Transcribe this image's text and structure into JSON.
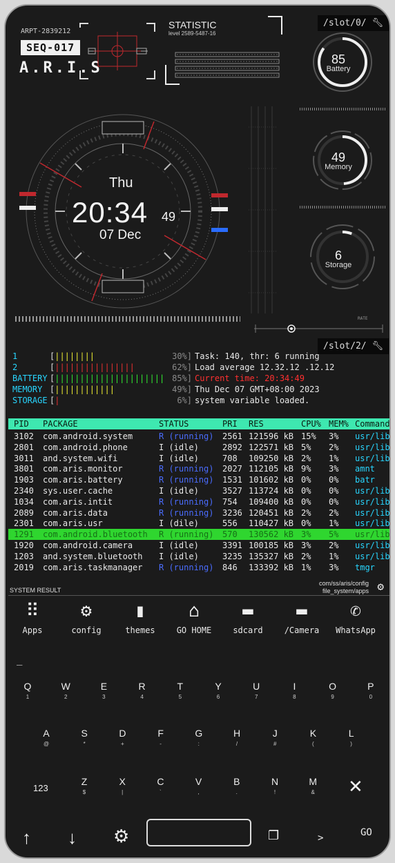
{
  "header": {
    "id_code": "ARPT-2839212",
    "seq": "SEQ-017",
    "brand": "A.R.I.S",
    "statistic_title": "STATISTIC",
    "statistic_level": "level 2589-5487-16",
    "slot0": "/slot/0/",
    "slot2": "/slot/2/"
  },
  "clock": {
    "day": "Thu",
    "time": "20:34",
    "seconds": "49",
    "date": "07 Dec"
  },
  "gauges": [
    {
      "value": "85",
      "label": "Battery",
      "fraction": 0.85
    },
    {
      "value": "49",
      "label": "Memory",
      "fraction": 0.49
    },
    {
      "value": "6",
      "label": "Storage",
      "fraction": 0.06
    }
  ],
  "rate_label": "RATE",
  "stats": [
    {
      "label": "1",
      "bars": 8,
      "bar_color": "#e8e830",
      "pct": "30%]",
      "msg": "Task: 140, thr: 6 running"
    },
    {
      "label": "2",
      "bars": 16,
      "bar_color": "#e83030",
      "pct": "62%]",
      "msg": "Load average 12.32.12 .12.12"
    },
    {
      "label": "BATTERY",
      "bars": 22,
      "bar_color": "#30e830",
      "pct": "85%]",
      "msg": "Current time: 20:34:49",
      "msg_color": "#ff3030"
    },
    {
      "label": "MEMORY",
      "bars": 12,
      "bar_color": "#e8e830",
      "pct": "49%]",
      "msg": "Thu Dec 07 GMT+08:00 2023"
    },
    {
      "label": "STORAGE",
      "bars": 1,
      "bar_color": "#e83030",
      "pct": "6%]",
      "msg": "system variable loaded."
    }
  ],
  "table": {
    "headers": [
      "PID",
      "PACKAGE",
      "STATUS",
      "PRI",
      "RES",
      "CPU%",
      "MEM%",
      "Command"
    ],
    "rows": [
      [
        "3102",
        "com.android.system",
        "R (running)",
        "2561",
        "121596 kB",
        "15%",
        "3%",
        "usr/lib"
      ],
      [
        "2801",
        "com.android.phone",
        "I (idle)",
        "2892",
        "122571 kB",
        "5%",
        "2%",
        "usr/lib"
      ],
      [
        "3011",
        "and.system.wifi",
        "I (idle)",
        "708",
        "109250 kB",
        "2%",
        "1%",
        "usr/lib"
      ],
      [
        "3801",
        "com.aris.monitor",
        "R (running)",
        "2027",
        "112105 kB",
        "9%",
        "3%",
        "amnt"
      ],
      [
        "1903",
        "com.aris.battery",
        "R (running)",
        "1531",
        "101602 kB",
        "0%",
        "0%",
        "batr"
      ],
      [
        "2340",
        "sys.user.cache",
        "I (idle)",
        "3527",
        "113724 kB",
        "0%",
        "0%",
        "usr/lib"
      ],
      [
        "1034",
        "com.aris.intit",
        "R (running)",
        "754",
        "109400 kB",
        "0%",
        "0%",
        "usr/lib"
      ],
      [
        "2089",
        "com.aris.data",
        "R (running)",
        "3236",
        "120451 kB",
        "2%",
        "2%",
        "usr/lib"
      ],
      [
        "2301",
        "com.aris.usr",
        "I (dile)",
        "556",
        "110427 kB",
        "0%",
        "1%",
        "usr/lib"
      ],
      [
        "1291",
        "com.android.bluetooth",
        "R (running)",
        "570",
        "130562 kB",
        "3%",
        "5%",
        "usr/lib"
      ],
      [
        "1920",
        "com.android.camera",
        "I (idle)",
        "3391",
        "100185 kB",
        "3%",
        "2%",
        "usr/lib"
      ],
      [
        "1203",
        "and.system.bluetooth",
        "I (idle)",
        "3235",
        "135327 kB",
        "2%",
        "1%",
        "usr/lib"
      ],
      [
        "2019",
        "com.aris.taskmanager",
        "R (running)",
        "846",
        "133392 kB",
        "1%",
        "3%",
        "tmgr"
      ]
    ],
    "highlighted_row": 9
  },
  "system_result": "SYSTEM RESULT",
  "path_line1": "com/ss/aris/config",
  "path_line2": "file_system/apps",
  "apps": [
    {
      "label": "Apps",
      "icon": "grid-icon"
    },
    {
      "label": "config",
      "icon": "gear-icon"
    },
    {
      "label": "themes",
      "icon": "paint-roller-icon"
    },
    {
      "label": "GO HOME",
      "icon": "home-icon"
    },
    {
      "label": "sdcard",
      "icon": "folder-icon"
    },
    {
      "label": "/Camera",
      "icon": "folder-icon"
    },
    {
      "label": "WhatsApp",
      "icon": "whatsapp-icon"
    }
  ],
  "input_cursor": "_",
  "keyboard": {
    "row1": [
      [
        "Q",
        "1"
      ],
      [
        "W",
        "2"
      ],
      [
        "E",
        "3"
      ],
      [
        "R",
        "4"
      ],
      [
        "T",
        "5"
      ],
      [
        "Y",
        "6"
      ],
      [
        "U",
        "7"
      ],
      [
        "I",
        "8"
      ],
      [
        "O",
        "9"
      ],
      [
        "P",
        "0"
      ]
    ],
    "row2": [
      [
        "A",
        "@"
      ],
      [
        "S",
        "*"
      ],
      [
        "D",
        "+"
      ],
      [
        "F",
        "-"
      ],
      [
        "G",
        ":"
      ],
      [
        "H",
        "/"
      ],
      [
        "J",
        "#"
      ],
      [
        "K",
        "("
      ],
      [
        "L",
        ")"
      ]
    ],
    "row3": [
      [
        "Z",
        "$"
      ],
      [
        "X",
        "|"
      ],
      [
        "C",
        "`"
      ],
      [
        "V",
        ","
      ],
      [
        "B",
        "."
      ],
      [
        "N",
        "!"
      ],
      [
        "M",
        "&"
      ]
    ],
    "num_key": "123",
    "delete_icon": "close-icon"
  },
  "bottom_bar": {
    "up": "up-arrow-icon",
    "down": "down-arrow-icon",
    "settings": "gear-icon",
    "copy": "copy-icon",
    "prompt": ">",
    "go": "GO"
  }
}
